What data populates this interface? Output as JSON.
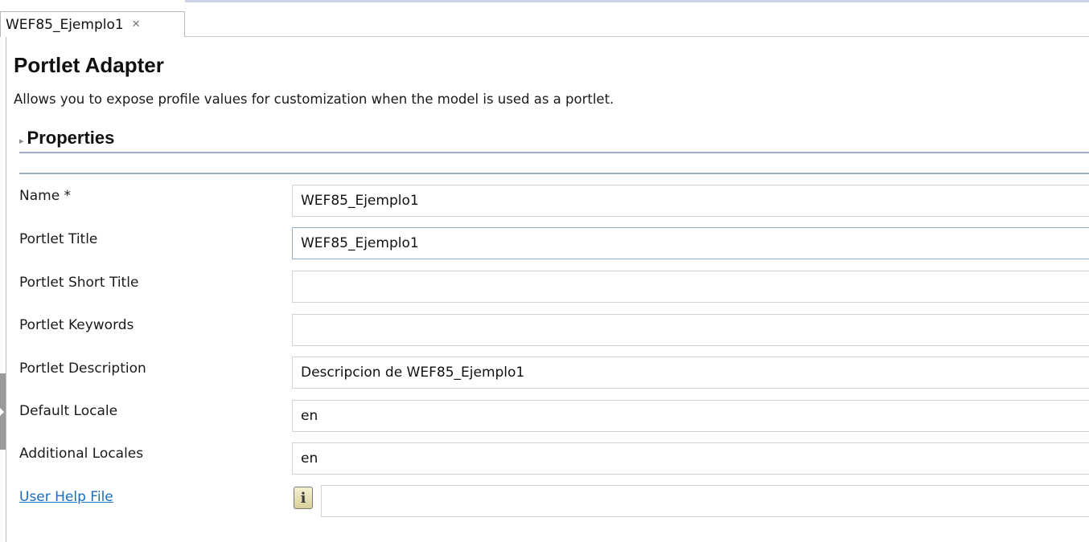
{
  "tab": {
    "label": "WEF85_Ejemplo1",
    "close_glyph": "✕"
  },
  "header": {
    "title": "Portlet Adapter",
    "description": "Allows you to expose profile values for customization when the model is used as a portlet."
  },
  "section": {
    "arrow_glyph": "▸",
    "title": "Properties"
  },
  "fields": [
    {
      "label": "Name *",
      "value": "WEF85_Ejemplo1"
    },
    {
      "label": "Portlet Title",
      "value": "WEF85_Ejemplo1"
    },
    {
      "label": "Portlet Short Title",
      "value": ""
    },
    {
      "label": "Portlet Keywords",
      "value": ""
    },
    {
      "label": "Portlet Description",
      "value": "Descripcion de WEF85_Ejemplo1"
    },
    {
      "label": "Default Locale",
      "value": "en"
    },
    {
      "label": "Additional Locales",
      "value": "en"
    },
    {
      "label": "User Help File",
      "value": "",
      "info_glyph": "i"
    }
  ]
}
